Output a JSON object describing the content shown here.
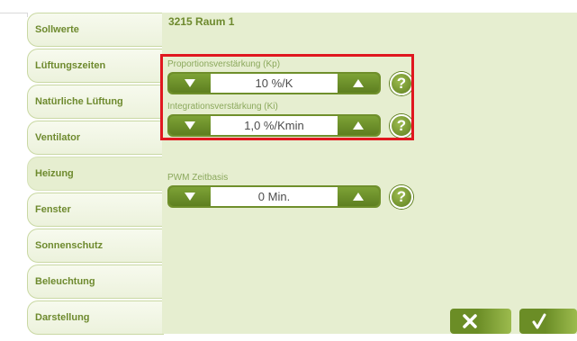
{
  "tabs": [
    {
      "label": "Sollwerte"
    },
    {
      "label": "Lüftungszeiten"
    },
    {
      "label": "Natürliche Lüftung"
    },
    {
      "label": "Ventilator"
    },
    {
      "label": "Heizung",
      "active": true
    },
    {
      "label": "Fenster"
    },
    {
      "label": "Sonnenschutz"
    },
    {
      "label": "Beleuchtung"
    },
    {
      "label": "Darstellung"
    }
  ],
  "room_title": "3215 Raum 1",
  "params": [
    {
      "label": "Proportionsverstärkung (Kp)",
      "value": "10 %/K"
    },
    {
      "label": "Integrationsverstärkung (Ki)",
      "value": "1,0 %/Kmin"
    },
    {
      "label": "PWM Zeitbasis",
      "value": "0 Min."
    }
  ],
  "icons": {
    "decrease": "arrow-down-icon",
    "increase": "arrow-up-icon",
    "help": "question-mark-icon",
    "cancel": "cross-icon",
    "confirm": "check-icon"
  },
  "help_symbol": "?",
  "colors": {
    "accent": "#6f8f2b",
    "panel": "#e6eed0",
    "highlight": "#e0171f"
  }
}
